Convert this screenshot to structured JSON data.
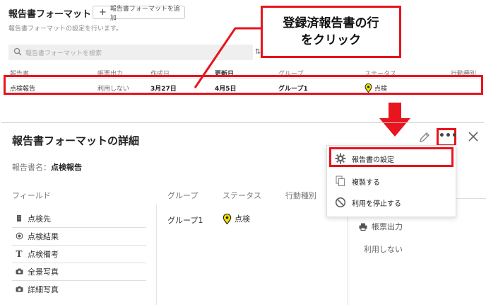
{
  "top": {
    "title": "報告書フォーマット",
    "add_button": "報告書フォーマットを追加",
    "subtitle": "報告書フォーマットの設定を行います。",
    "search_placeholder": "報告書フォーマットを検索",
    "columns": [
      "報告書",
      "帳票出力",
      "作成日",
      "更新日",
      "グループ",
      "ステータス",
      "行動種別"
    ],
    "row": {
      "name": "点検報告",
      "output": "利用しない",
      "created": "3月27日",
      "updated": "4月5日",
      "group": "グループ1",
      "status": "点検"
    }
  },
  "callout": {
    "line1": "登録済報告書の行",
    "line2": "をクリック"
  },
  "detail": {
    "title": "報告書フォーマットの詳細",
    "name_label": "報告書名：",
    "name_value": "点検報告",
    "col_fields": "フィールド",
    "col_group": "グループ",
    "col_status": "ステータス",
    "col_action": "行動種別",
    "fields": [
      "点検先",
      "点検結果",
      "点検備考",
      "全景写真",
      "詳細写真"
    ],
    "group_value": "グループ1",
    "status_value": "点検",
    "side_heading": "帳票出力",
    "side_value": "利用しない"
  },
  "menu": {
    "items": [
      "報告書の設定",
      "複製する",
      "利用を停止する"
    ]
  },
  "colors": {
    "highlight": "#e8141e",
    "status_pin": "#f2e200"
  }
}
